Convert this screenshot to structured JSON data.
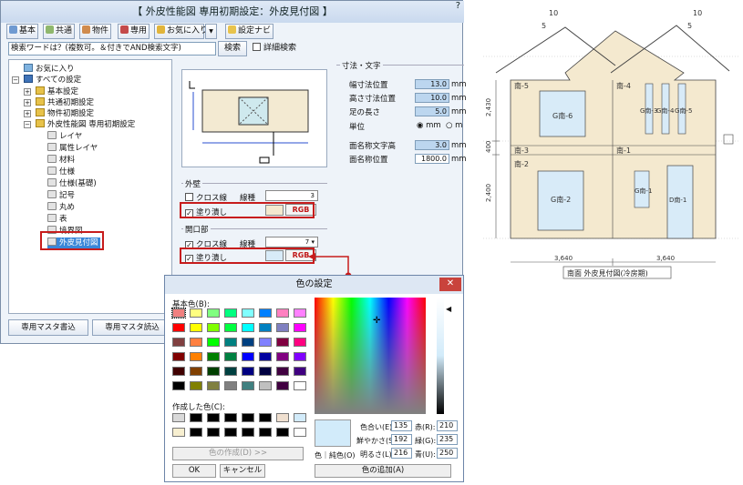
{
  "window": {
    "title": "【 外皮性能図 専用初期設定：外皮見付図 】",
    "help": "?"
  },
  "toolbar": {
    "basic": "基本",
    "common": "共通",
    "property": "物件",
    "dedicated": "専用",
    "favorite": "お気に入り",
    "dropdown": "▼",
    "navi": "設定ナビ"
  },
  "search": {
    "placeholder": "検索ワードは？(複数可。＆付きでAND検索文字)",
    "button": "検索",
    "detail": "詳細検索"
  },
  "tree": {
    "favorites": "お気に入り",
    "all": "すべての設定",
    "basic": "基本設定",
    "common": "共通初期設定",
    "property": "物件初期設定",
    "envelope": "外皮性能図 専用初期設定",
    "items": [
      "レイヤ",
      "属性レイヤ",
      "材料",
      "仕様",
      "仕様(基礎)",
      "記号",
      "丸め",
      "表",
      "境界図"
    ],
    "selected": "外皮見付図"
  },
  "buttons": {
    "write": "専用マスタ書込",
    "read": "専用マスタ読込"
  },
  "dim": {
    "title": "寸法・文字",
    "rows": [
      {
        "label": "幅寸法位置",
        "value": "13.0",
        "unit": "mm"
      },
      {
        "label": "高さ寸法位置",
        "value": "10.0",
        "unit": "mm"
      },
      {
        "label": "足の長さ",
        "value": "5.0",
        "unit": "mm"
      }
    ],
    "unit_label": "単位",
    "unit_mm": "mm",
    "unit_m": "m",
    "name_height_label": "面名称文字高",
    "name_height_value": "3.0",
    "name_height_unit": "mm",
    "name_pos_label": "面名称位置",
    "name_pos_value": "1800.0",
    "name_pos_unit": "mm"
  },
  "outer_wall": {
    "title": "外壁",
    "cross_label": "クロス線",
    "linetype_label": "線種",
    "linetype_value": "3",
    "fill_label": "塗り潰し",
    "rgb": "RGB"
  },
  "opening": {
    "title": "開口部",
    "cross_label": "クロス線",
    "linetype_label": "線種",
    "linetype_value": "7",
    "fill_label": "塗り潰し",
    "rgb": "RGB"
  },
  "color_dialog": {
    "title": "色の設定",
    "basic_label": "基本色(B):",
    "custom_label": "作成した色(C):",
    "define_btn": "色の作成(D) >>",
    "ok": "OK",
    "cancel": "キャンセル",
    "add_btn": "色の追加(A)",
    "color_label": "色｜純色(O)",
    "hue_label": "色合い(E):",
    "hue": "135",
    "sat_label": "鮮やかさ(S):",
    "sat": "192",
    "lum_label": "明るさ(L):",
    "lum": "216",
    "red_label": "赤(R):",
    "red": "210",
    "green_label": "緑(G):",
    "green": "235",
    "blue_label": "青(U):",
    "blue": "250",
    "selected_color": "#d2ebfa"
  },
  "basic_colors": [
    "#f08080",
    "#ffff80",
    "#80ff80",
    "#00ff80",
    "#80ffff",
    "#0080ff",
    "#ff80c0",
    "#ff80ff",
    "#ff0000",
    "#ffff00",
    "#80ff00",
    "#00ff40",
    "#00ffff",
    "#0080c0",
    "#8080c0",
    "#ff00ff",
    "#804040",
    "#ff8040",
    "#00ff00",
    "#008080",
    "#004080",
    "#8080ff",
    "#800040",
    "#ff0080",
    "#800000",
    "#ff8000",
    "#008000",
    "#008040",
    "#0000ff",
    "#0000a0",
    "#800080",
    "#8000ff",
    "#400000",
    "#804000",
    "#004000",
    "#004040",
    "#000080",
    "#000040",
    "#400040",
    "#400080",
    "#000000",
    "#808000",
    "#808040",
    "#808080",
    "#408080",
    "#c0c0c0",
    "#400040",
    "#ffffff"
  ],
  "custom_colors": [
    "#d9d9d9",
    "#000000",
    "#000000",
    "#000000",
    "#000000",
    "#000000",
    "#f0e0d0",
    "#d2ebfa",
    "#f7efd0",
    "#000000",
    "#000000",
    "#000000",
    "#000000",
    "#000000",
    "#000000",
    "#ffffff"
  ],
  "drawing": {
    "pitch_top": "10",
    "pitch_side": "5",
    "labels": [
      "南-5",
      "南-4",
      "南-3",
      "南-1",
      "南-2"
    ],
    "windows": [
      "G南-6",
      "G南-3",
      "G南-4",
      "G南-5",
      "G南-2",
      "G南-1",
      "D南-1"
    ],
    "dim_left": [
      "2,430",
      "400",
      "2,400"
    ],
    "dim_bottom": [
      "3,640",
      "3,640"
    ],
    "caption": "南面 外皮見付図(冷房期)",
    "colors": {
      "wall": "#f4e9cf",
      "opening": "#d8ebf8",
      "dim": "#555555"
    }
  }
}
